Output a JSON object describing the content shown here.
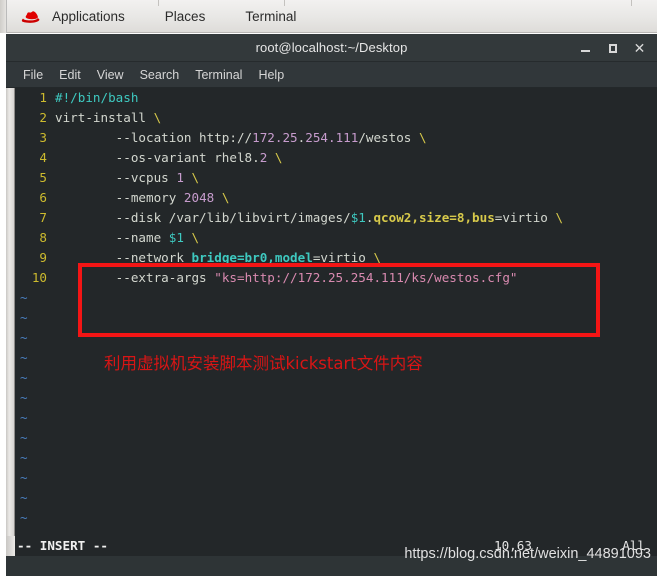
{
  "desktop_panel": {
    "logo_icon": "redhat-fedora-icon",
    "items": [
      {
        "label": "Applications"
      },
      {
        "label": "Places"
      },
      {
        "label": "Terminal"
      }
    ]
  },
  "window": {
    "title": "root@localhost:~/Desktop",
    "controls": {
      "minimize": "minimize-icon",
      "maximize": "maximize-icon",
      "close": "close-icon"
    }
  },
  "menubar": {
    "items": [
      {
        "label": "File"
      },
      {
        "label": "Edit"
      },
      {
        "label": "View"
      },
      {
        "label": "Search"
      },
      {
        "label": "Terminal"
      },
      {
        "label": "Help"
      }
    ]
  },
  "editor": {
    "lines": [
      {
        "num": "1",
        "segments": [
          {
            "t": "#!/bin/bash",
            "c": "fg-comment"
          }
        ]
      },
      {
        "num": "2",
        "segments": [
          {
            "t": "virt-install ",
            "c": "fg-default"
          },
          {
            "t": "\\",
            "c": "fg-cont"
          }
        ]
      },
      {
        "num": "3",
        "segments": [
          {
            "t": "        --location http://",
            "c": "fg-default"
          },
          {
            "t": "172.25",
            "c": "fg-num"
          },
          {
            "t": ".",
            "c": "fg-default"
          },
          {
            "t": "254.111",
            "c": "fg-num"
          },
          {
            "t": "/westos ",
            "c": "fg-default"
          },
          {
            "t": "\\",
            "c": "fg-cont"
          }
        ]
      },
      {
        "num": "4",
        "segments": [
          {
            "t": "        --os-variant rhel8.",
            "c": "fg-default"
          },
          {
            "t": "2",
            "c": "fg-num"
          },
          {
            "t": " ",
            "c": "fg-default"
          },
          {
            "t": "\\",
            "c": "fg-cont"
          }
        ]
      },
      {
        "num": "5",
        "segments": [
          {
            "t": "        --vcpus ",
            "c": "fg-default"
          },
          {
            "t": "1",
            "c": "fg-num"
          },
          {
            "t": " ",
            "c": "fg-default"
          },
          {
            "t": "\\",
            "c": "fg-cont"
          }
        ]
      },
      {
        "num": "6",
        "segments": [
          {
            "t": "        --memory ",
            "c": "fg-default"
          },
          {
            "t": "2048",
            "c": "fg-num"
          },
          {
            "t": " ",
            "c": "fg-default"
          },
          {
            "t": "\\",
            "c": "fg-cont"
          }
        ]
      },
      {
        "num": "7",
        "segments": [
          {
            "t": "        --disk /var/lib/libvirt/images/",
            "c": "fg-default"
          },
          {
            "t": "$1",
            "c": "fg-var"
          },
          {
            "t": ".",
            "c": "fg-default"
          },
          {
            "t": "qcow2,size=8,bus",
            "c": "fg-key"
          },
          {
            "t": "=virtio ",
            "c": "fg-default"
          },
          {
            "t": "\\",
            "c": "fg-cont"
          }
        ]
      },
      {
        "num": "8",
        "segments": [
          {
            "t": "        --name ",
            "c": "fg-default"
          },
          {
            "t": "$1",
            "c": "fg-var"
          },
          {
            "t": " ",
            "c": "fg-default"
          },
          {
            "t": "\\",
            "c": "fg-cont"
          }
        ]
      },
      {
        "num": "9",
        "segments": [
          {
            "t": "        --network ",
            "c": "fg-default"
          },
          {
            "t": "bridge=br0,model",
            "c": "fg-keyc"
          },
          {
            "t": "=virtio ",
            "c": "fg-default"
          },
          {
            "t": "\\",
            "c": "fg-cont"
          }
        ]
      },
      {
        "num": "10",
        "segments": [
          {
            "t": "        --extra-args ",
            "c": "fg-default"
          },
          {
            "t": "\"ks=http://172.25.254.111/ks/westos.cfg\"",
            "c": "fg-string"
          }
        ]
      }
    ],
    "empty_marker": "~",
    "empty_line_count": 13
  },
  "annotations": {
    "red_box": {
      "color": "#f41515"
    },
    "chinese_note": "利用虚拟机安装脚本测试kickstart文件内容",
    "chinese_note_color": "#d81515"
  },
  "statusbar": {
    "mode": "-- INSERT --",
    "cursor": "10,63",
    "scroll": "All"
  },
  "watermark": "https://blog.csdn.net/weixin_44891093"
}
